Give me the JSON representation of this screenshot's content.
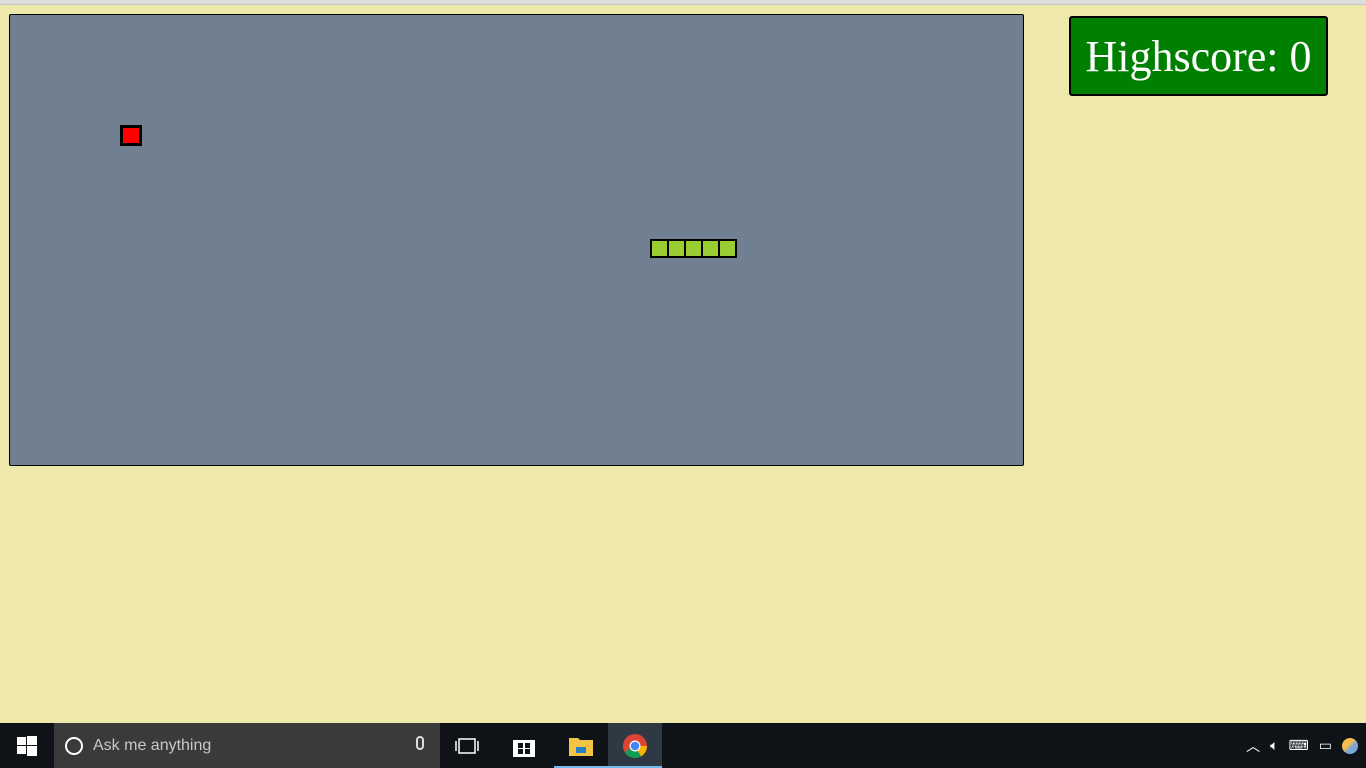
{
  "game": {
    "highscore_text": "Highscore: 0",
    "board_color": "#708090",
    "background_color": "#EEE8AA",
    "food_color": "#FF0000",
    "snake_color": "#9ACD32",
    "snake_length": 5
  },
  "taskbar": {
    "search_placeholder": "Ask me anything",
    "start_icon": "windows-logo-icon",
    "pinned": [
      {
        "name": "task-view-icon"
      },
      {
        "name": "store-icon"
      },
      {
        "name": "file-explorer-icon"
      },
      {
        "name": "chrome-icon"
      }
    ],
    "tray_icons": [
      "chevron-up-icon",
      "volume-icon",
      "input-icon",
      "network-icon",
      "weather-icon"
    ]
  }
}
